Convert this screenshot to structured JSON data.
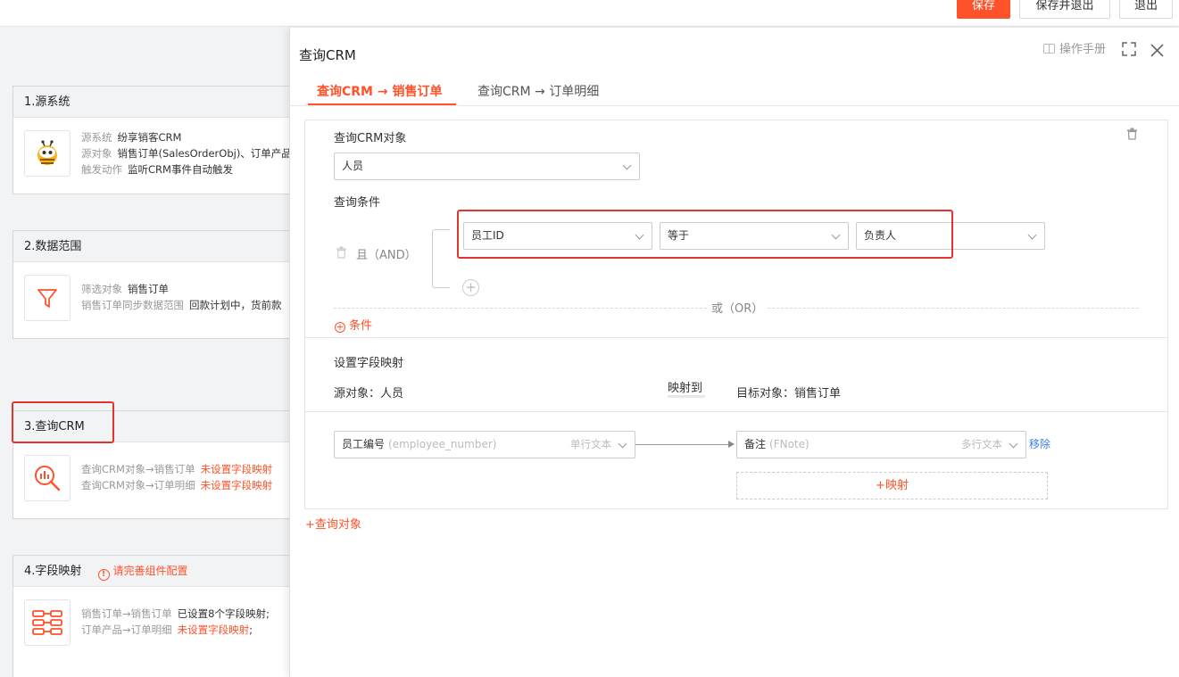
{
  "toolbar": {
    "save": "保存",
    "save_exit": "保存并退出",
    "exit": "退出"
  },
  "steps": [
    {
      "title": "1.源系统",
      "rows": [
        {
          "k": "源系统",
          "v": "纷享销客CRM"
        },
        {
          "k": "源对象",
          "v": "销售订单(SalesOrderObj)、订单产品"
        },
        {
          "k": "触发动作",
          "v": "监听CRM事件自动触发"
        }
      ]
    },
    {
      "title": "2.数据范围",
      "rows": [
        {
          "k": "筛选对象",
          "v": "销售订单"
        },
        {
          "k": "销售订单同步数据范围",
          "v": "回款计划中，货前款"
        }
      ]
    },
    {
      "title": "3.查询CRM",
      "rows": [
        {
          "k": "查询CRM对象→销售订单",
          "v": "未设置字段映射"
        },
        {
          "k": "查询CRM对象→订单明细",
          "v": "未设置字段映射"
        }
      ]
    },
    {
      "title": "4.字段映射",
      "tip": "请完善组件配置",
      "rows": [
        {
          "k": "销售订单→销售订单",
          "v": "已设置8个字段映射;"
        },
        {
          "k": "订单产品→订单明细",
          "v": "未设置字段映射",
          "tail": ";"
        }
      ]
    }
  ],
  "drawer": {
    "title": "查询CRM",
    "manual": "操作手册",
    "tabs": [
      "查询CRM → 销售订单",
      "查询CRM → 订单明细"
    ],
    "query_object_label": "查询CRM对象",
    "query_object_value": "人员",
    "condition_label": "查询条件",
    "and_label": "且（AND）",
    "or_label": "或（OR）",
    "condition": {
      "field": "员工ID",
      "op": "等于",
      "value": "负责人"
    },
    "add_condition": "条件",
    "mapping_label": "设置字段映射",
    "source_obj": "源对象：人员",
    "maps_to": "映射到",
    "target_obj": "目标对象：销售订单",
    "mapping": {
      "src_name": "员工编号",
      "src_api": "(employee_number)",
      "src_type": "单行文本",
      "dst_name": "备注",
      "dst_api": "(FNote)",
      "dst_type": "多行文本",
      "remove": "移除"
    },
    "add_mapping": "+映射",
    "add_query_object": "+查询对象"
  },
  "colors": {
    "accent": "#ff522a",
    "highlight": "#e3342f",
    "link": "#3c7ee3"
  }
}
